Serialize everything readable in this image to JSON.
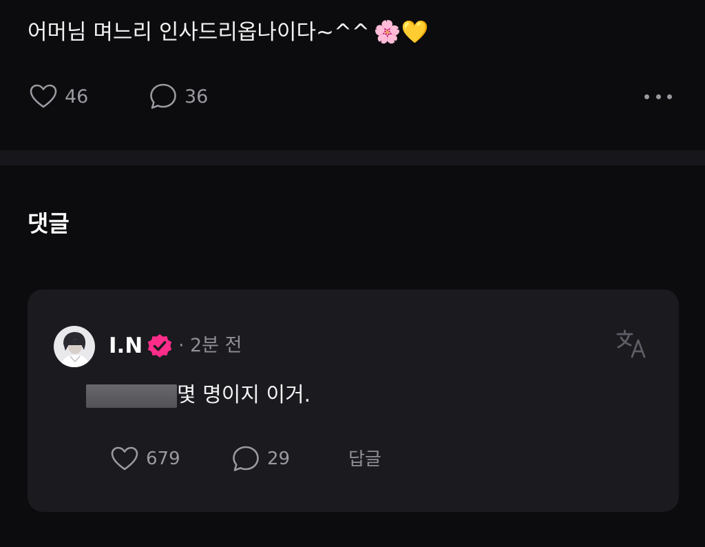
{
  "post": {
    "text": "어머님 며느리 인사드리옵나이다~^^",
    "emojis": "🌸💛",
    "like_count": "46",
    "comment_count": "36"
  },
  "comments_section": {
    "title": "댓글"
  },
  "comment": {
    "author": "I.N",
    "separator": "·",
    "time": "2분 전",
    "text": "몇 명이지 이거.",
    "like_count": "679",
    "reply_count": "29",
    "reply_label": "답글"
  },
  "colors": {
    "background": "#0c0c0e",
    "card": "#1a1a1f",
    "muted": "#9a9aa1",
    "verified": "#ff2d8a"
  }
}
